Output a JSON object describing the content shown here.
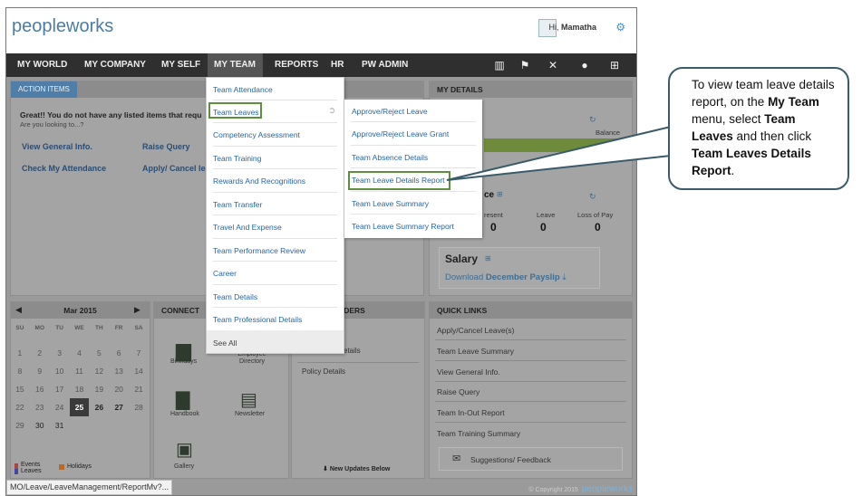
{
  "header": {
    "logo_text": "peopleworks",
    "greeting": "Hi,",
    "user_name": "Mamatha"
  },
  "nav": {
    "items": [
      "MY WORLD",
      "MY COMPANY",
      "MY SELF",
      "MY TEAM",
      "REPORTS",
      "HR",
      "PW ADMIN"
    ]
  },
  "action_items": {
    "tab": "ACTION ITEMS",
    "message": "Great!! You do not have any listed items that requ",
    "sub": "Are you looking to...?",
    "links": [
      "View General Info.",
      "Raise Query",
      "Check My Attendance",
      "Apply/ Cancel lea"
    ]
  },
  "my_details": {
    "title": "MY DETAILS",
    "balance_label": "Balance",
    "attendance_title": "ce",
    "cols": [
      "resent",
      "Leave",
      "Loss of Pay"
    ],
    "values": [
      "0",
      "0",
      "0"
    ],
    "salary_title": "Salary",
    "payslip_prefix": "Download ",
    "payslip_bold": "December Payslip"
  },
  "calendar": {
    "month": "Mar 2015",
    "days": [
      "SU",
      "MO",
      "TU",
      "WE",
      "TH",
      "FR",
      "SA"
    ],
    "rows": [
      [
        "1",
        "2",
        "3",
        "4",
        "5",
        "6",
        "7"
      ],
      [
        "8",
        "9",
        "10",
        "11",
        "12",
        "13",
        "14"
      ],
      [
        "15",
        "16",
        "17",
        "18",
        "19",
        "20",
        "21"
      ],
      [
        "22",
        "23",
        "24",
        "25",
        "26",
        "27",
        "28"
      ],
      [
        "29",
        "30",
        "31",
        "",
        "",
        "",
        ""
      ]
    ],
    "today": "25",
    "legend_events": "Events",
    "legend_leaves": "Leaves",
    "legend_holidays": "Holidays"
  },
  "connect": {
    "title": "CONNECT",
    "items": [
      "Birthdays",
      "Employee Directory",
      "Handbook",
      "Newsletter",
      "Gallery"
    ]
  },
  "reminders": {
    "title": "LDERS",
    "items": [
      "etails",
      "Policy Details"
    ],
    "footer": "New Updates Below"
  },
  "quick_links": {
    "title": "QUICK LINKS",
    "items": [
      "Apply/Cancel Leave(s)",
      "Team Leave Summary",
      "View General Info.",
      "Raise Query",
      "Team In-Out Report",
      "Team Training Summary"
    ],
    "feedback": "Suggestions/ Feedback"
  },
  "menu_my_team": {
    "items": [
      "Team Attendance",
      "Team Leaves",
      "Competency Assessment",
      "Team Training",
      "Rewards And Recognitions",
      "Team Transfer",
      "Travel And Expense",
      "Team Performance Review",
      "Career",
      "Team Details",
      "Team Professional Details",
      "See All"
    ]
  },
  "submenu_team_leaves": {
    "items": [
      "Approve/Reject Leave",
      "Approve/Reject Leave Grant",
      "Team Absence Details",
      "Team Leave Details Report",
      "Team Leave Summary",
      "Team Leave Summary Report"
    ]
  },
  "status_bar": "MO/Leave/LeaveManagement/ReportMv?...",
  "footer": {
    "copyright": "© Copyright 2015",
    "logo": "peopleworks"
  },
  "callout": {
    "t1": "To view team leave details report, on the ",
    "b1": "My Team",
    "t2": " menu, select ",
    "b2": "Team Leaves",
    "t3": " and then click ",
    "b3": "Team Leaves Details Report",
    "t4": "."
  }
}
